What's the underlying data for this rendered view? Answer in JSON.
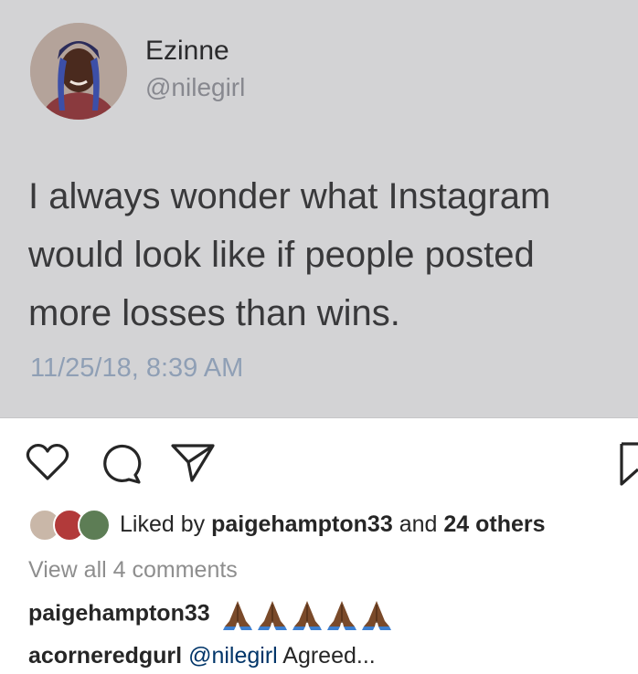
{
  "tweet": {
    "display_name": "Ezinne",
    "handle": "@nilegirl",
    "text": "I always wonder what Instagram would look like if people posted more losses than wins.",
    "timestamp": "11/25/18, 8:39 AM"
  },
  "actions": {
    "icons": [
      "heart-icon",
      "comment-icon",
      "share-icon",
      "bookmark-icon"
    ]
  },
  "likes": {
    "prefix": "Liked by",
    "user": "paigehampton33",
    "middle": "and",
    "others": "24 others"
  },
  "view_comments": "View all 4 comments",
  "comments": [
    {
      "user": "paigehampton33",
      "text": "",
      "emoji_count": 5
    },
    {
      "user": "acorneredgurl",
      "mention": "@nilegirl",
      "text": "Agreed..."
    }
  ],
  "colors": {
    "tweet_bg": "#d3d3d5",
    "timestamp": "#8f9fb5",
    "mention": "#003569"
  }
}
